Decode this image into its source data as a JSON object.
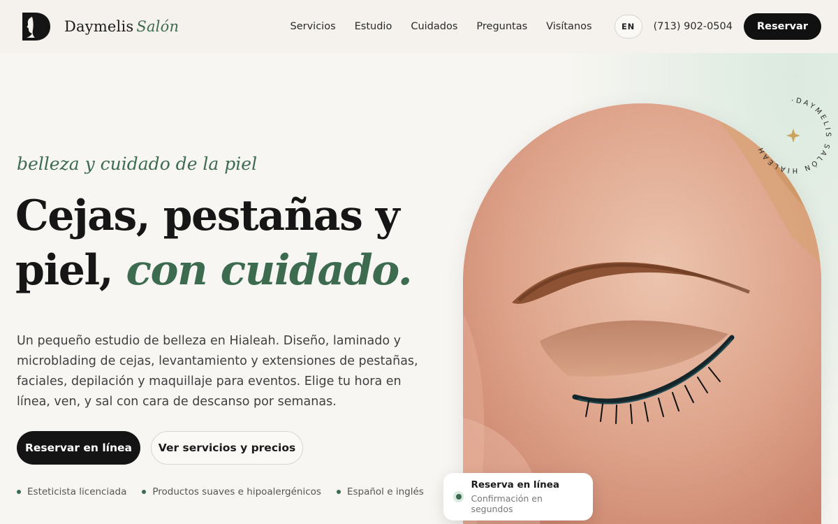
{
  "header": {
    "brand": {
      "name": "Daymelis",
      "accent": "Salón"
    },
    "nav": [
      "Servicios",
      "Estudio",
      "Cuidados",
      "Preguntas",
      "Visítanos"
    ],
    "language": "EN",
    "phone": "(713) 902-0504",
    "book_label": "Reservar"
  },
  "hero": {
    "tagline": "belleza y cuidado de la piel",
    "headline_line1": "Cejas, pestañas y",
    "headline_line2_plain": "piel, ",
    "headline_line2_accent": "con cuidado.",
    "intro": "Un pequeño estudio de belleza en Hialeah. Diseño, laminado y microblading de cejas, levantamiento y extensiones de pestañas, faciales, depilación y maquillaje para eventos. Elige tu hora en línea, ven, y sal con cara de descanso por semanas.",
    "cta_primary": "Reservar en línea",
    "cta_secondary": "Ver servicios y precios",
    "features": [
      "Esteticista licenciada",
      "Productos suaves e hipoalergénicos",
      "Español e inglés"
    ]
  },
  "stamp": {
    "text": "·DAYMELIS SALÓN HIALEAH"
  },
  "status_card": {
    "title": "Reserva en línea",
    "subtitle": "Confirmación en segundos"
  },
  "icons": {
    "logo": "d-portrait-logo",
    "stamp_star": "sparkle-icon",
    "status": "status-dot-icon"
  },
  "colors": {
    "accent": "#3c6b4f",
    "dark": "#111111",
    "background": "#f8f6f2",
    "gold": "#c9a45a"
  }
}
